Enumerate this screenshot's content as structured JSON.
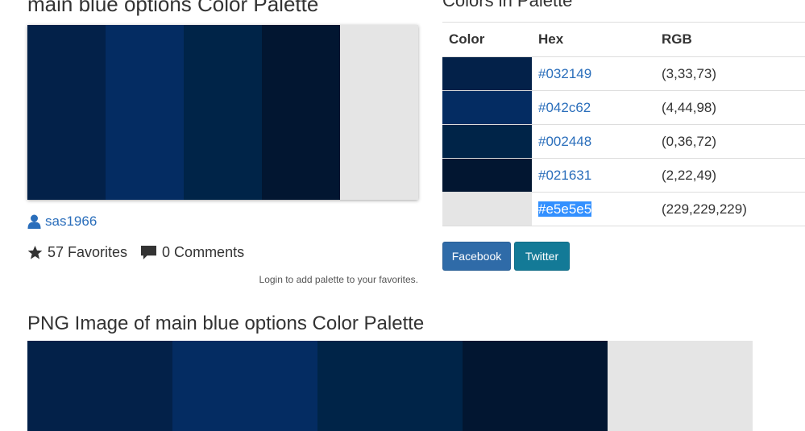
{
  "palette": {
    "title": "main blue options Color Palette",
    "colors": [
      "#032149",
      "#042c62",
      "#002448",
      "#021631",
      "#e5e5e5"
    ],
    "author": "sas1966",
    "favorites": "57 Favorites",
    "comments": "0 Comments",
    "login_note": "Login to add palette to your favorites."
  },
  "colors_table": {
    "title": "Colors in Palette",
    "headers": {
      "color": "Color",
      "hex": "Hex",
      "rgb": "RGB"
    },
    "rows": [
      {
        "hex": "#032149",
        "rgb": "(3,33,73)"
      },
      {
        "hex": "#042c62",
        "rgb": "(4,44,98)"
      },
      {
        "hex": "#002448",
        "rgb": "(0,36,72)"
      },
      {
        "hex": "#021631",
        "rgb": "(2,22,49)"
      },
      {
        "hex": "#e5e5e5",
        "rgb": "(229,229,229)"
      }
    ],
    "selected_row": 4
  },
  "share": {
    "facebook": "Facebook",
    "twitter": "Twitter"
  },
  "png": {
    "title": "PNG Image of main blue options Color Palette"
  },
  "icons": {
    "user": "user-icon",
    "star": "star-icon",
    "comment": "comment-icon"
  }
}
